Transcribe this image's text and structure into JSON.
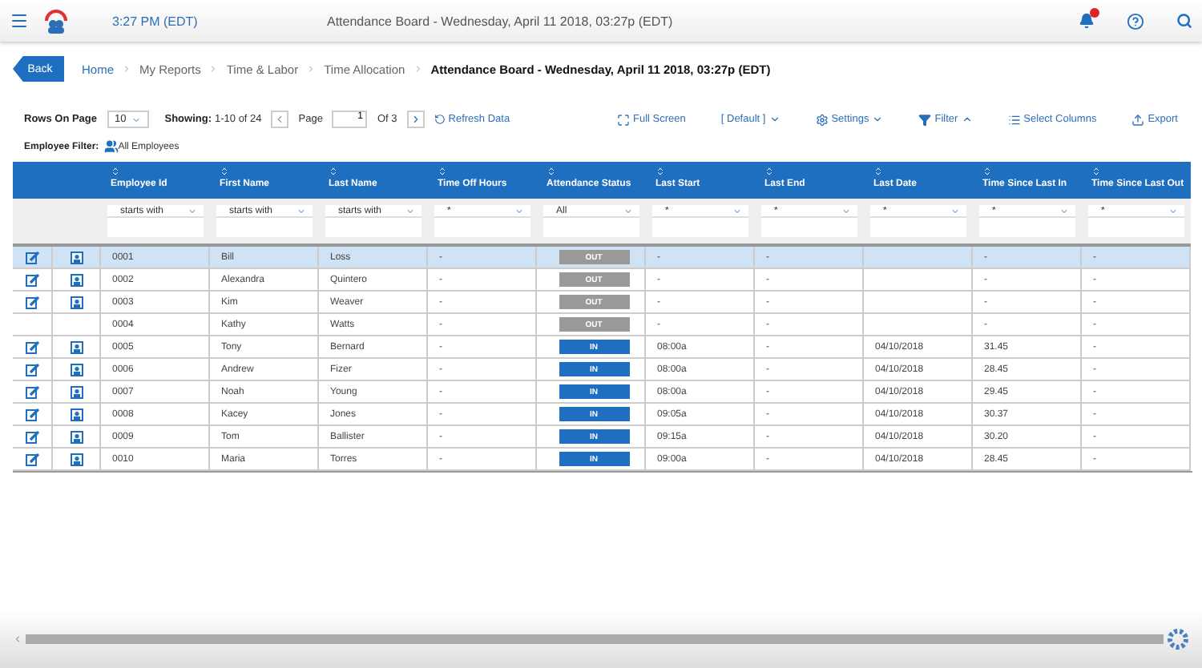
{
  "top_bar": {
    "time": "3:27 PM (EDT)",
    "title": "Attendance Board - Wednesday, April 11 2018, 03:27p (EDT)"
  },
  "back_button": "Back",
  "breadcrumb": [
    {
      "label": "Home",
      "kind": "link"
    },
    {
      "label": "My Reports",
      "kind": "plain"
    },
    {
      "label": "Time & Labor",
      "kind": "plain"
    },
    {
      "label": "Time Allocation",
      "kind": "plain"
    },
    {
      "label": "Attendance Board - Wednesday, April 11 2018, 03:27p (EDT)",
      "kind": "current"
    }
  ],
  "toolbar": {
    "rows_label": "Rows On Page",
    "rows_value": "10",
    "showing_label": "Showing:",
    "showing_value": "1-10 of 24",
    "page_label": "Page",
    "page_value": "1",
    "page_of": "Of 3",
    "refresh": "Refresh Data",
    "actions": [
      {
        "label": "Full Screen",
        "kind": "fullscreen"
      },
      {
        "label": "[ Default ]",
        "kind": "default"
      },
      {
        "label": "Settings",
        "kind": "settings"
      },
      {
        "label": "Filter",
        "kind": "filter"
      },
      {
        "label": "Select Columns",
        "kind": "columns"
      },
      {
        "label": "Export",
        "kind": "export"
      }
    ]
  },
  "employee_filter": {
    "label": "Employee Filter:",
    "value": "All Employees"
  },
  "table": {
    "columns": [
      {
        "label": "Employee Id",
        "filter": "starts with"
      },
      {
        "label": "First Name",
        "filter": "starts with"
      },
      {
        "label": "Last Name",
        "filter": "starts with"
      },
      {
        "label": "Time Off Hours",
        "filter": "*"
      },
      {
        "label": "Attendance Status",
        "filter": "All"
      },
      {
        "label": "Last Start",
        "filter": "*"
      },
      {
        "label": "Last End",
        "filter": "*"
      },
      {
        "label": "Last Date",
        "filter": "*"
      },
      {
        "label": "Time Since Last In",
        "filter": "*"
      },
      {
        "label": "Time Since Last Out",
        "filter": "*"
      }
    ],
    "rows": [
      {
        "selected": true,
        "actions": true,
        "kind": "out",
        "cells": [
          "0001",
          "Bill",
          "Loss",
          "-",
          "OUT",
          "-",
          "-",
          "",
          "-",
          "-"
        ]
      },
      {
        "selected": false,
        "actions": true,
        "kind": "out",
        "cells": [
          "0002",
          "Alexandra",
          "Quintero",
          "-",
          "OUT",
          "-",
          "-",
          "",
          "-",
          "-"
        ]
      },
      {
        "selected": false,
        "actions": true,
        "kind": "out",
        "cells": [
          "0003",
          "Kim",
          "Weaver",
          "-",
          "OUT",
          "-",
          "-",
          "",
          "-",
          "-"
        ]
      },
      {
        "selected": false,
        "actions": false,
        "kind": "out",
        "cells": [
          "0004",
          "Kathy",
          "Watts",
          "-",
          "OUT",
          "-",
          "-",
          "",
          "-",
          "-"
        ]
      },
      {
        "selected": false,
        "actions": true,
        "kind": "in",
        "cells": [
          "0005",
          "Tony",
          "Bernard",
          "-",
          "IN",
          "08:00a",
          "-",
          "04/10/2018",
          "31.45",
          "-"
        ]
      },
      {
        "selected": false,
        "actions": true,
        "kind": "in",
        "cells": [
          "0006",
          "Andrew",
          "Fizer",
          "-",
          "IN",
          "08:00a",
          "-",
          "04/10/2018",
          "28.45",
          "-"
        ]
      },
      {
        "selected": false,
        "actions": true,
        "kind": "in",
        "cells": [
          "0007",
          "Noah",
          "Young",
          "-",
          "IN",
          "08:00a",
          "-",
          "04/10/2018",
          "29.45",
          "-"
        ]
      },
      {
        "selected": false,
        "actions": true,
        "kind": "in",
        "cells": [
          "0008",
          "Kacey",
          "Jones",
          "-",
          "IN",
          "09:05a",
          "-",
          "04/10/2018",
          "30.37",
          "-"
        ]
      },
      {
        "selected": false,
        "actions": true,
        "kind": "in",
        "cells": [
          "0009",
          "Tom",
          "Ballister",
          "-",
          "IN",
          "09:15a",
          "-",
          "04/10/2018",
          "30.20",
          "-"
        ]
      },
      {
        "selected": false,
        "actions": true,
        "kind": "in",
        "cells": [
          "0010",
          "Maria",
          "Torres",
          "-",
          "IN",
          "09:00a",
          "-",
          "04/10/2018",
          "28.45",
          "-"
        ]
      }
    ]
  }
}
